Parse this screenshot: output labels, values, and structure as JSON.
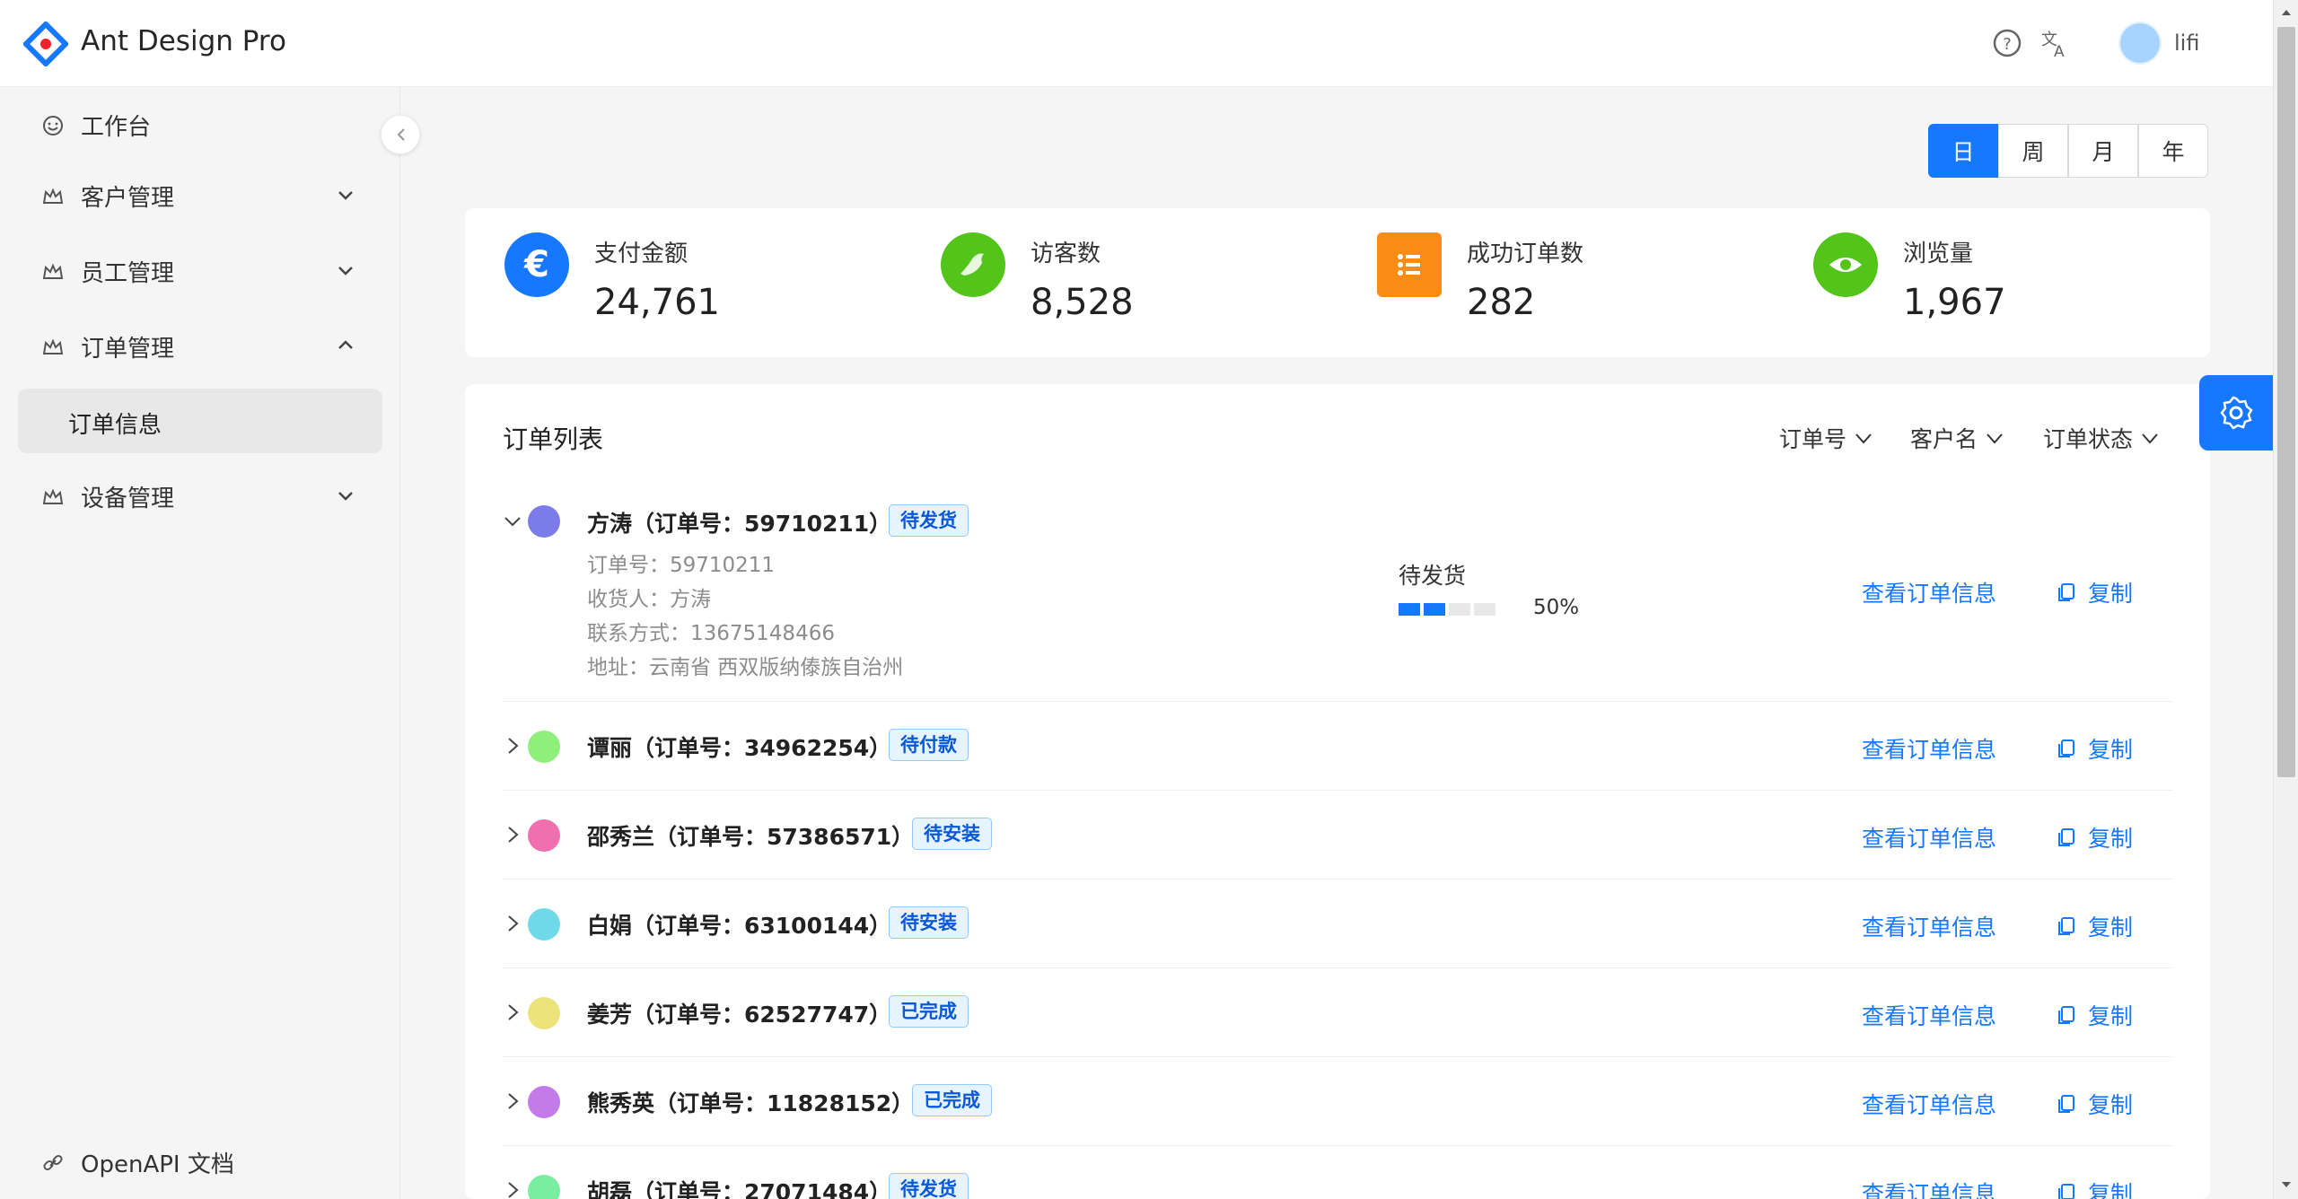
{
  "header": {
    "app_title": "Ant Design Pro",
    "username": "lifi",
    "icons": [
      "logo-icon",
      "question-icon",
      "translate-icon",
      "avatar"
    ]
  },
  "sidebar": {
    "items": [
      {
        "label": "工作台",
        "icon": "smile-icon"
      },
      {
        "label": "客户管理",
        "icon": "crown-icon"
      },
      {
        "label": "员工管理",
        "icon": "crown-icon"
      },
      {
        "label": "订单管理",
        "icon": "crown-icon"
      },
      {
        "label": "订单信息"
      },
      {
        "label": "设备管理",
        "icon": "crown-icon"
      }
    ],
    "footer_link": "OpenAPI 文档"
  },
  "periods": [
    "日",
    "周",
    "月",
    "年"
  ],
  "active_period": "日",
  "stats": [
    {
      "title": "支付金额",
      "value": "24,761",
      "icon": "euro-icon",
      "color": "#1677ff"
    },
    {
      "title": "访客数",
      "value": "8,528",
      "icon": "bird-icon",
      "color": "#52c41a"
    },
    {
      "title": "成功订单数",
      "value": "282",
      "icon": "list-icon",
      "color": "#fa8c16"
    },
    {
      "title": "浏览量",
      "value": "1,967",
      "icon": "eye-icon",
      "color": "#52c41a"
    }
  ],
  "order_list": {
    "title": "订单列表",
    "filters": [
      "订单号",
      "客户名",
      "订单状态"
    ],
    "detail_labels": {
      "order_no": "订单号：59710211",
      "receiver": "收货人：方涛",
      "phone": "联系方式：13675148466",
      "address": "地址：云南省 西双版纳傣族自治州"
    },
    "expanded_status": "待发货",
    "expanded_progress_percent": 50,
    "expanded_progress_label": "50%",
    "view_label": "查看订单信息",
    "copy_label": "复制",
    "orders": [
      {
        "name": "方涛（订单号：59710211）",
        "status": "待发货",
        "avatar_color": "#7b7bea",
        "expanded": true
      },
      {
        "name": "谭丽（订单号：34962254）",
        "status": "待付款",
        "avatar_color": "#8ef07a"
      },
      {
        "name": "邵秀兰（订单号：57386571）",
        "status": "待安装",
        "avatar_color": "#f06fae"
      },
      {
        "name": "白娟（订单号：63100144）",
        "status": "待安装",
        "avatar_color": "#6fd9ea"
      },
      {
        "name": "姜芳（订单号：62527747）",
        "status": "已完成",
        "avatar_color": "#ece47a"
      },
      {
        "name": "熊秀英（订单号：11828152）",
        "status": "已完成",
        "avatar_color": "#c47bea"
      },
      {
        "name": "胡磊（订单号：27071484）",
        "status": "待发货",
        "avatar_color": "#7aeea0"
      }
    ]
  },
  "colors": {
    "primary": "#1677ff",
    "tag_bg": "#e6f4ff",
    "tag_border": "#91caff"
  }
}
